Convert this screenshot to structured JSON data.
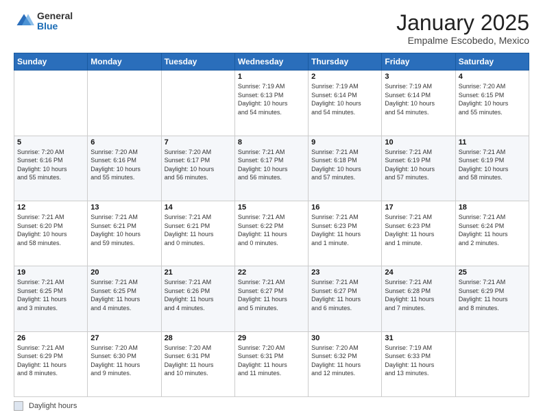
{
  "header": {
    "logo_general": "General",
    "logo_blue": "Blue",
    "month": "January 2025",
    "location": "Empalme Escobedo, Mexico"
  },
  "days_of_week": [
    "Sunday",
    "Monday",
    "Tuesday",
    "Wednesday",
    "Thursday",
    "Friday",
    "Saturday"
  ],
  "weeks": [
    [
      {
        "day": "",
        "detail": ""
      },
      {
        "day": "",
        "detail": ""
      },
      {
        "day": "",
        "detail": ""
      },
      {
        "day": "1",
        "detail": "Sunrise: 7:19 AM\nSunset: 6:13 PM\nDaylight: 10 hours\nand 54 minutes."
      },
      {
        "day": "2",
        "detail": "Sunrise: 7:19 AM\nSunset: 6:14 PM\nDaylight: 10 hours\nand 54 minutes."
      },
      {
        "day": "3",
        "detail": "Sunrise: 7:19 AM\nSunset: 6:14 PM\nDaylight: 10 hours\nand 54 minutes."
      },
      {
        "day": "4",
        "detail": "Sunrise: 7:20 AM\nSunset: 6:15 PM\nDaylight: 10 hours\nand 55 minutes."
      }
    ],
    [
      {
        "day": "5",
        "detail": "Sunrise: 7:20 AM\nSunset: 6:16 PM\nDaylight: 10 hours\nand 55 minutes."
      },
      {
        "day": "6",
        "detail": "Sunrise: 7:20 AM\nSunset: 6:16 PM\nDaylight: 10 hours\nand 55 minutes."
      },
      {
        "day": "7",
        "detail": "Sunrise: 7:20 AM\nSunset: 6:17 PM\nDaylight: 10 hours\nand 56 minutes."
      },
      {
        "day": "8",
        "detail": "Sunrise: 7:21 AM\nSunset: 6:17 PM\nDaylight: 10 hours\nand 56 minutes."
      },
      {
        "day": "9",
        "detail": "Sunrise: 7:21 AM\nSunset: 6:18 PM\nDaylight: 10 hours\nand 57 minutes."
      },
      {
        "day": "10",
        "detail": "Sunrise: 7:21 AM\nSunset: 6:19 PM\nDaylight: 10 hours\nand 57 minutes."
      },
      {
        "day": "11",
        "detail": "Sunrise: 7:21 AM\nSunset: 6:19 PM\nDaylight: 10 hours\nand 58 minutes."
      }
    ],
    [
      {
        "day": "12",
        "detail": "Sunrise: 7:21 AM\nSunset: 6:20 PM\nDaylight: 10 hours\nand 58 minutes."
      },
      {
        "day": "13",
        "detail": "Sunrise: 7:21 AM\nSunset: 6:21 PM\nDaylight: 10 hours\nand 59 minutes."
      },
      {
        "day": "14",
        "detail": "Sunrise: 7:21 AM\nSunset: 6:21 PM\nDaylight: 11 hours\nand 0 minutes."
      },
      {
        "day": "15",
        "detail": "Sunrise: 7:21 AM\nSunset: 6:22 PM\nDaylight: 11 hours\nand 0 minutes."
      },
      {
        "day": "16",
        "detail": "Sunrise: 7:21 AM\nSunset: 6:23 PM\nDaylight: 11 hours\nand 1 minute."
      },
      {
        "day": "17",
        "detail": "Sunrise: 7:21 AM\nSunset: 6:23 PM\nDaylight: 11 hours\nand 1 minute."
      },
      {
        "day": "18",
        "detail": "Sunrise: 7:21 AM\nSunset: 6:24 PM\nDaylight: 11 hours\nand 2 minutes."
      }
    ],
    [
      {
        "day": "19",
        "detail": "Sunrise: 7:21 AM\nSunset: 6:25 PM\nDaylight: 11 hours\nand 3 minutes."
      },
      {
        "day": "20",
        "detail": "Sunrise: 7:21 AM\nSunset: 6:25 PM\nDaylight: 11 hours\nand 4 minutes."
      },
      {
        "day": "21",
        "detail": "Sunrise: 7:21 AM\nSunset: 6:26 PM\nDaylight: 11 hours\nand 4 minutes."
      },
      {
        "day": "22",
        "detail": "Sunrise: 7:21 AM\nSunset: 6:27 PM\nDaylight: 11 hours\nand 5 minutes."
      },
      {
        "day": "23",
        "detail": "Sunrise: 7:21 AM\nSunset: 6:27 PM\nDaylight: 11 hours\nand 6 minutes."
      },
      {
        "day": "24",
        "detail": "Sunrise: 7:21 AM\nSunset: 6:28 PM\nDaylight: 11 hours\nand 7 minutes."
      },
      {
        "day": "25",
        "detail": "Sunrise: 7:21 AM\nSunset: 6:29 PM\nDaylight: 11 hours\nand 8 minutes."
      }
    ],
    [
      {
        "day": "26",
        "detail": "Sunrise: 7:21 AM\nSunset: 6:29 PM\nDaylight: 11 hours\nand 8 minutes."
      },
      {
        "day": "27",
        "detail": "Sunrise: 7:20 AM\nSunset: 6:30 PM\nDaylight: 11 hours\nand 9 minutes."
      },
      {
        "day": "28",
        "detail": "Sunrise: 7:20 AM\nSunset: 6:31 PM\nDaylight: 11 hours\nand 10 minutes."
      },
      {
        "day": "29",
        "detail": "Sunrise: 7:20 AM\nSunset: 6:31 PM\nDaylight: 11 hours\nand 11 minutes."
      },
      {
        "day": "30",
        "detail": "Sunrise: 7:20 AM\nSunset: 6:32 PM\nDaylight: 11 hours\nand 12 minutes."
      },
      {
        "day": "31",
        "detail": "Sunrise: 7:19 AM\nSunset: 6:33 PM\nDaylight: 11 hours\nand 13 minutes."
      },
      {
        "day": "",
        "detail": ""
      }
    ]
  ],
  "footer": {
    "legend_label": "Daylight hours"
  }
}
